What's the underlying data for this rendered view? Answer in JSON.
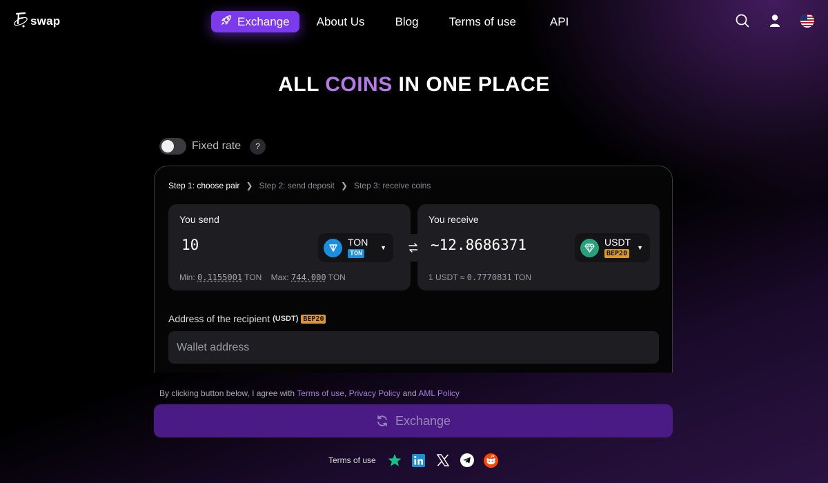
{
  "header": {
    "logo_text": "swap",
    "nav": [
      {
        "label": "Exchange",
        "active": true
      },
      {
        "label": "About Us"
      },
      {
        "label": "Blog"
      },
      {
        "label": "Terms of use"
      },
      {
        "label": "API"
      }
    ],
    "icons": [
      "search-icon",
      "user-icon",
      "us-flag-icon"
    ]
  },
  "hero": {
    "title_before": "ALL ",
    "title_accent": "COINS",
    "title_after": " IN ONE PLACE"
  },
  "fixed_rate": {
    "label": "Fixed rate",
    "enabled": false,
    "help": "?"
  },
  "steps": [
    "Step 1: choose pair",
    "Step 2: send deposit",
    "Step 3: receive coins"
  ],
  "send": {
    "label": "You send",
    "amount": "10",
    "coin": "TON",
    "network": "TON",
    "min_label": "Min:",
    "min_value": "0.1155001",
    "max_label": "Max:",
    "max_value": "744.000",
    "unit": "TON"
  },
  "receive": {
    "label": "You receive",
    "amount": "~12.8686371",
    "coin": "USDT",
    "network": "BEP20",
    "rate_left": "1 USDT ≈",
    "rate_value": "0.7770831",
    "rate_unit": "TON"
  },
  "recipient": {
    "label": "Address of the recipient",
    "coin_tag": "(USDT)",
    "network": "BEP20",
    "placeholder": "Wallet address"
  },
  "agreement": {
    "text_before": "By clicking button below, I agree with ",
    "link1": "Terms of use",
    "sep": ", ",
    "link2": "Privacy Policy",
    "and": " and ",
    "link3": "AML Policy"
  },
  "exchange_button": "Exchange",
  "footer": {
    "link": "Terms of use",
    "icons": [
      "trustpilot-icon",
      "linkedin-icon",
      "x-icon",
      "telegram-icon",
      "reddit-icon"
    ]
  },
  "colors": {
    "accent": "#7c3aed",
    "button": "#4a1a85",
    "ton": "#1a8fe0",
    "usdt": "#26a17b",
    "bep20": "#d99a2b"
  }
}
